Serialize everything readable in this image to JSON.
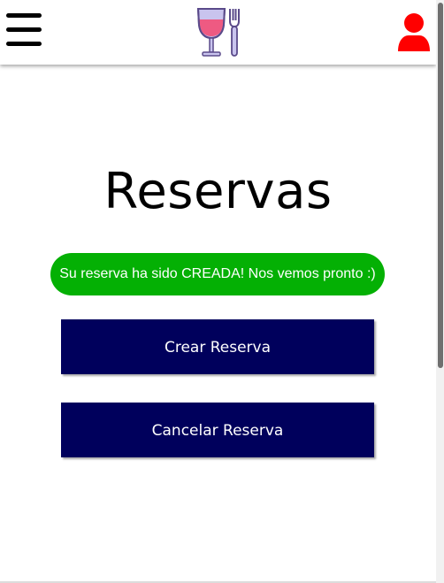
{
  "header": {
    "menu_icon": "hamburger-menu-icon",
    "logo_icon": "wine-glass-fork-icon",
    "user_icon": "user-icon"
  },
  "main": {
    "title": "Reservas",
    "alert": {
      "text": "Su reserva ha sido CREADA! Nos vemos pronto :)",
      "color": "#04b004"
    },
    "buttons": [
      {
        "label": "Crear Reserva"
      },
      {
        "label": "Cancelar Reserva"
      }
    ],
    "button_color": "#00005c"
  },
  "colors": {
    "user_icon": "#ff0000",
    "logo_glass": "#ee5a82",
    "logo_outline": "#5a4a8a",
    "logo_fill": "#c9c4ee"
  }
}
